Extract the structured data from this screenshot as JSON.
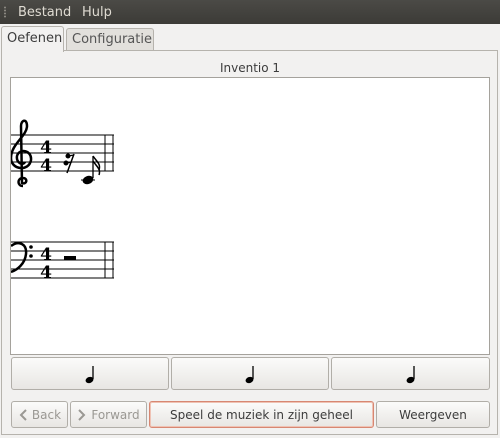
{
  "menubar": {
    "items": [
      "Bestand",
      "Hulp"
    ]
  },
  "tabs": [
    {
      "label": "Oefenen",
      "active": true
    },
    {
      "label": "Configuratie",
      "active": false
    }
  ],
  "exercise": {
    "title": "Inventio 1"
  },
  "score": {
    "treble_time": [
      "4",
      "4"
    ],
    "bass_time": [
      "4",
      "4"
    ]
  },
  "answers": [
    {
      "icon": "quarter-note-icon"
    },
    {
      "icon": "quarter-note-icon"
    },
    {
      "icon": "quarter-note-icon"
    }
  ],
  "buttons": {
    "back": "Back",
    "forward": "Forward",
    "play": "Speel de muziek in zijn geheel",
    "show": "Weergeven"
  },
  "colors": {
    "menubar": "#3c3b37",
    "focus": "#d78772",
    "window_bg": "#f2f1f0"
  }
}
